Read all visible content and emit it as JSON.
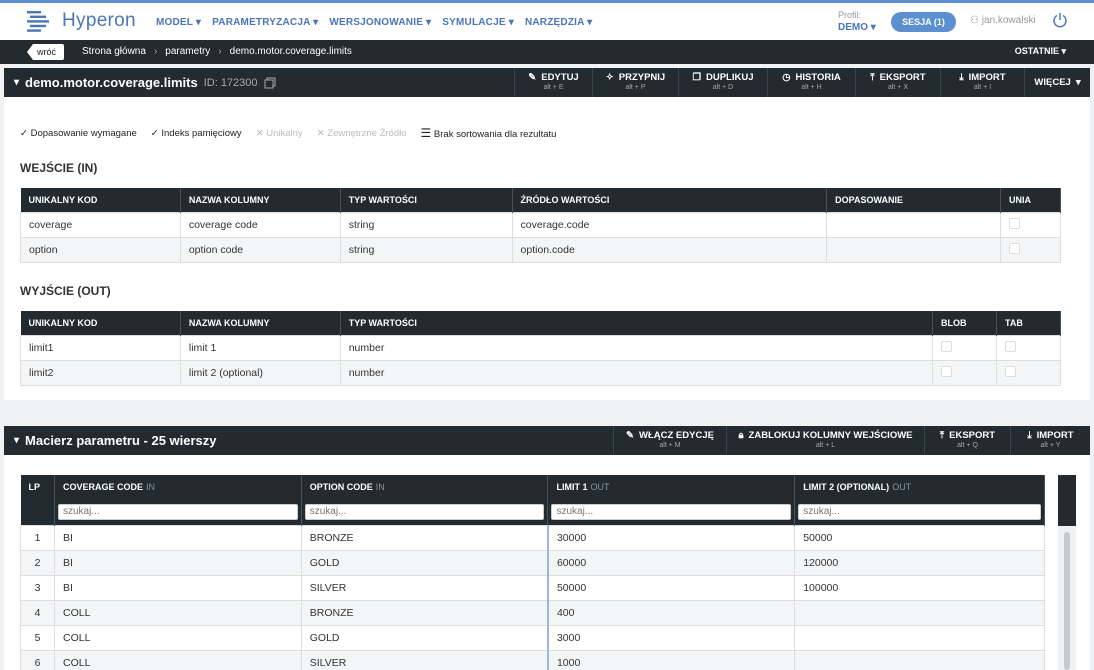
{
  "app": {
    "brand": "Hyperon"
  },
  "menu": [
    "MODEL",
    "PARAMETRYZACJA",
    "WERSJONOWANIE",
    "SYMULACJE",
    "NARZĘDZIA"
  ],
  "profile": {
    "label": "Profil:",
    "value": "DEMO"
  },
  "session": {
    "label": "SESJA (1)"
  },
  "user": {
    "name": "jan.kowalski"
  },
  "breadcrumb": {
    "back": "wróć",
    "items": [
      "Strona główna",
      "parametry",
      "demo.motor.coverage.limits"
    ],
    "recent": "OSTATNIE"
  },
  "param": {
    "title": "demo.motor.coverage.limits",
    "id": "ID: 172300",
    "toolbar": [
      {
        "label": "EDYTUJ",
        "key": "alt + E",
        "icon": "pencil-icon"
      },
      {
        "label": "PRZYPNIJ",
        "key": "alt + P",
        "icon": "pin-icon"
      },
      {
        "label": "DUPLIKUJ",
        "key": "alt + D",
        "icon": "copy-icon"
      },
      {
        "label": "HISTORIA",
        "key": "alt + H",
        "icon": "clock-icon"
      },
      {
        "label": "EKSPORT",
        "key": "alt + X",
        "icon": "upload-icon"
      },
      {
        "label": "IMPORT",
        "key": "alt + I",
        "icon": "download-icon"
      }
    ],
    "more": "WIĘCEJ",
    "flags": [
      {
        "label": "Dopasowanie wymagane",
        "on": true
      },
      {
        "label": "Indeks pamięciowy",
        "on": true
      },
      {
        "label": "Unikalny",
        "on": false
      },
      {
        "label": "Zewnętrzne Źródło",
        "on": false
      },
      {
        "label": "Brak sortowania dla rezultatu",
        "on": true
      }
    ]
  },
  "input": {
    "title": "WEJŚCIE (IN)",
    "headers": [
      "UNIKALNY KOD",
      "NAZWA KOLUMNY",
      "TYP WARTOŚCI",
      "ŹRÓDŁO WARTOŚCI",
      "DOPASOWANIE",
      "UNIA"
    ],
    "rows": [
      [
        "coverage",
        "coverage code",
        "string",
        "coverage.code",
        ""
      ],
      [
        "option",
        "option code",
        "string",
        "option.code",
        ""
      ]
    ]
  },
  "output": {
    "title": "WYJŚCIE (OUT)",
    "headers": [
      "UNIKALNY KOD",
      "NAZWA KOLUMNY",
      "TYP WARTOŚCI",
      "BLOB",
      "TAB"
    ],
    "rows": [
      [
        "limit1",
        "limit 1",
        "number"
      ],
      [
        "limit2",
        "limit 2 (optional)",
        "number"
      ]
    ]
  },
  "matrix": {
    "title": "Macierz parametru - 25 wierszy",
    "toolbar": [
      {
        "label": "WŁĄCZ EDYCJĘ",
        "key": "alt + M",
        "icon": "pencil-icon"
      },
      {
        "label": "ZABLOKUJ KOLUMNY WEJŚCIOWE",
        "key": "alt + L",
        "icon": "lock-icon"
      },
      {
        "label": "EKSPORT",
        "key": "alt + Q",
        "icon": "upload-icon"
      },
      {
        "label": "IMPORT",
        "key": "alt + Y",
        "icon": "download-icon"
      }
    ],
    "headers": [
      {
        "label": "LP",
        "tag": ""
      },
      {
        "label": "COVERAGE CODE",
        "tag": "IN"
      },
      {
        "label": "OPTION CODE",
        "tag": "IN"
      },
      {
        "label": "LIMIT 1",
        "tag": "OUT"
      },
      {
        "label": "LIMIT 2 (OPTIONAL)",
        "tag": "OUT"
      }
    ],
    "search_placeholder": "szukaj...",
    "rows": [
      [
        "1",
        "BI",
        "BRONZE",
        "30000",
        "50000"
      ],
      [
        "2",
        "BI",
        "GOLD",
        "60000",
        "120000"
      ],
      [
        "3",
        "BI",
        "SILVER",
        "50000",
        "100000"
      ],
      [
        "4",
        "COLL",
        "BRONZE",
        "400",
        ""
      ],
      [
        "5",
        "COLL",
        "GOLD",
        "3000",
        ""
      ],
      [
        "6",
        "COLL",
        "SILVER",
        "1000",
        ""
      ]
    ]
  }
}
